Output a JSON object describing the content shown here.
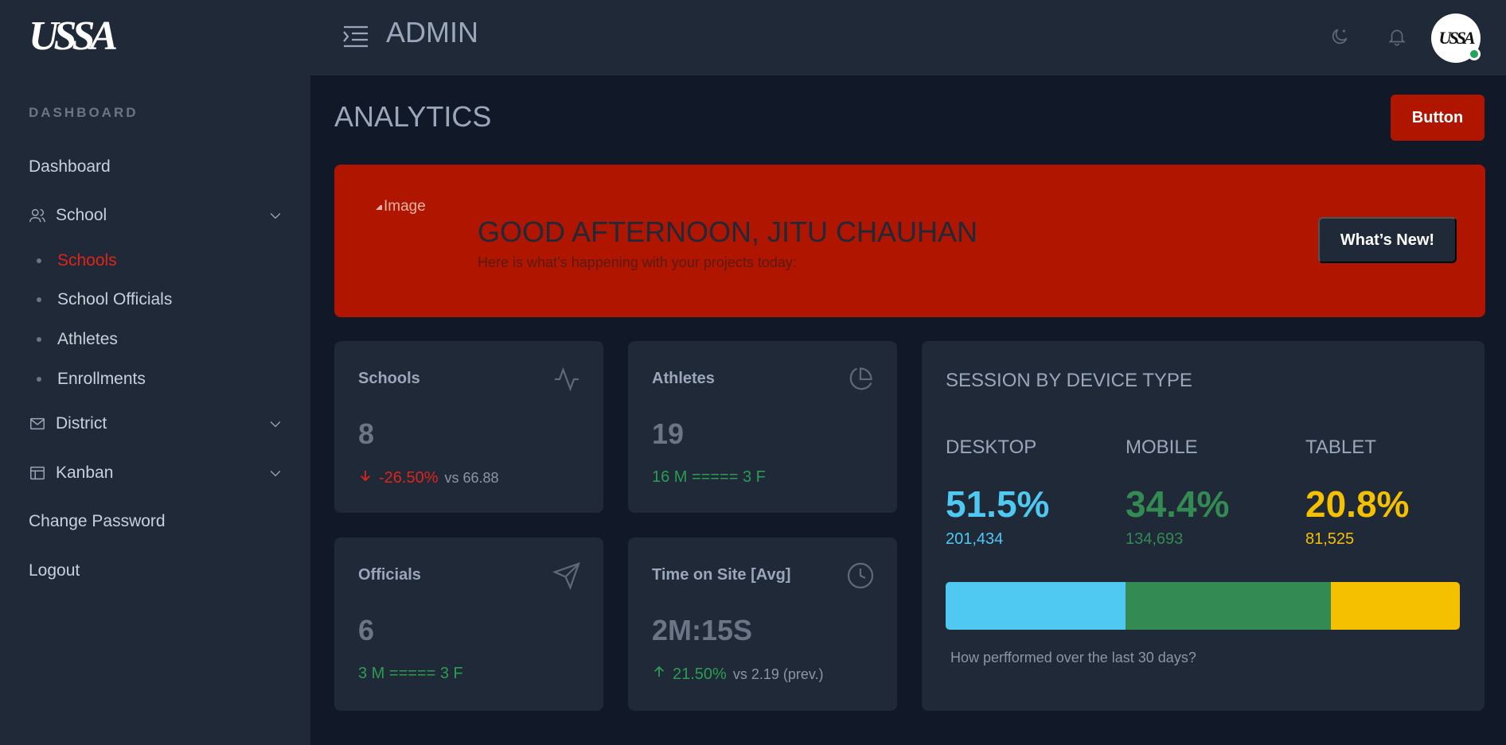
{
  "brand": {
    "logo_text": "USSA"
  },
  "sidebar": {
    "section_title": "DASHBOARD",
    "items": [
      {
        "label": "Dashboard"
      },
      {
        "label": "School",
        "icon": "users-icon",
        "children": [
          {
            "label": "Schools",
            "active": true
          },
          {
            "label": "School Officials"
          },
          {
            "label": "Athletes"
          },
          {
            "label": "Enrollments"
          }
        ]
      },
      {
        "label": "District",
        "icon": "mail-icon"
      },
      {
        "label": "Kanban",
        "icon": "layout-icon"
      },
      {
        "label": "Change Password"
      },
      {
        "label": "Logout"
      }
    ]
  },
  "header": {
    "title": "ADMIN",
    "avatar_text": "USSA"
  },
  "page": {
    "title": "ANALYTICS",
    "action_button": "Button"
  },
  "banner": {
    "image_alt": "Image",
    "greeting": "GOOD AFTERNOON, JITU CHAUHAN",
    "subtitle": "Here is what’s happening with your projects today:",
    "button": "What’s New!"
  },
  "stats": {
    "schools": {
      "label": "Schools",
      "value": "8",
      "change": "-26.50%",
      "compare": "vs 66.88",
      "icon": "activity-icon"
    },
    "athletes": {
      "label": "Athletes",
      "value": "19",
      "breakdown": "16 M ===== 3 F",
      "icon": "pie-chart-icon"
    },
    "officials": {
      "label": "Officials",
      "value": "6",
      "breakdown": "3 M ===== 3 F",
      "icon": "send-icon"
    },
    "time": {
      "label": "Time on Site [Avg]",
      "value": "2M:15S",
      "change": "21.50%",
      "compare": "vs 2.19 (prev.)",
      "icon": "clock-icon"
    }
  },
  "session": {
    "title": "SESSION BY DEVICE TYPE",
    "devices": [
      {
        "name": "DESKTOP",
        "percent": "51.5%",
        "count": "201,434",
        "color": "#4fc8f2",
        "share": 35
      },
      {
        "name": "MOBILE",
        "percent": "34.4%",
        "count": "134,693",
        "color": "#338a52",
        "share": 40
      },
      {
        "name": "TABLET",
        "percent": "20.8%",
        "count": "81,525",
        "color": "#f5c000",
        "share": 25
      }
    ],
    "footer": "How perfformed over the last 30 days?"
  }
}
